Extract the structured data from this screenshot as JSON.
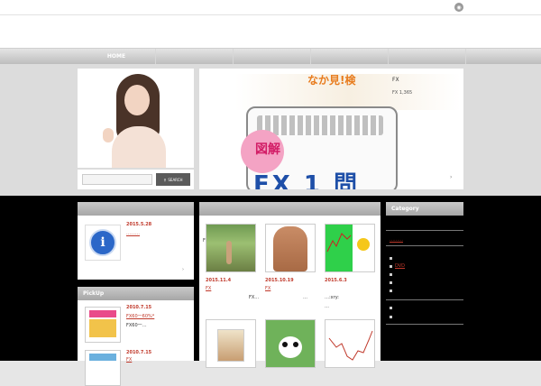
{
  "topbar": {
    "rss_icon": "rss-icon"
  },
  "nav": {
    "items": [
      "HOME"
    ]
  },
  "search": {
    "placeholder": "",
    "button_label": "SEARCH"
  },
  "banner": {
    "title": "なか見!検",
    "fx_tag": "FX",
    "sub": "FX 1,365",
    "zukai": "図解",
    "big": "FX 1 問"
  },
  "left_block": {
    "date": "2015.5.28",
    "link": "………"
  },
  "pickup": {
    "header": "PickUp",
    "items": [
      {
        "date": "2010.7.15",
        "title": "FX60一60%*",
        "excerpt": "FX60一…"
      },
      {
        "date": "2010.7.15",
        "title": "FX",
        "excerpt": ""
      }
    ]
  },
  "center": {
    "posts": [
      {
        "date": "2015.11.4",
        "tag": "FX",
        "excerpt": "",
        "side_label": "FX"
      },
      {
        "date": "2015.10.19",
        "tag": "FX",
        "excerpt": "FX…"
      },
      {
        "date": "2015.6.3",
        "tag": "",
        "excerpt": "…:xry:"
      }
    ],
    "dots": "…",
    "more": "…"
  },
  "category": {
    "header": "Category",
    "items": [
      "",
      "………",
      "",
      "",
      "DVD",
      "",
      "",
      "",
      "",
      ""
    ]
  },
  "colors": {
    "accent": "#c0392b",
    "nav": "#bdbdbd",
    "black": "#000000"
  }
}
